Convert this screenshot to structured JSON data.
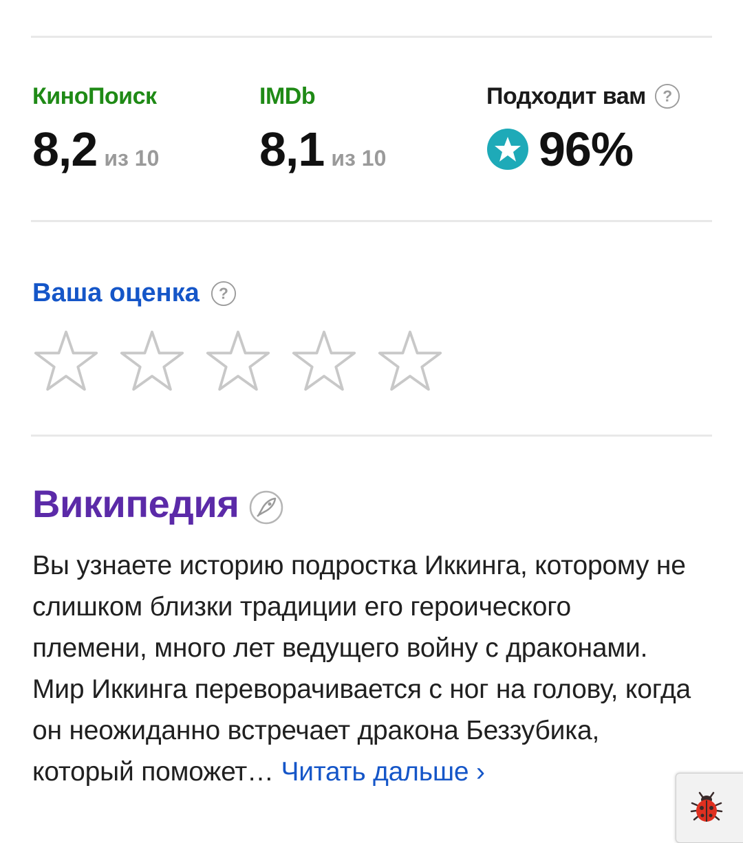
{
  "ratings": {
    "kinopoisk": {
      "label": "КиноПоиск",
      "value": "8,2",
      "scale": "из 10",
      "color": "#1f8a16"
    },
    "imdb": {
      "label": "IMDb",
      "value": "8,1",
      "scale": "из 10",
      "color": "#1f8a16"
    },
    "match": {
      "label": "Подходит вам",
      "value": "96%",
      "icon": "star-badge-icon",
      "badge_color": "#1eaab8"
    }
  },
  "your_rating": {
    "label": "Ваша оценка",
    "stars_total": 5,
    "stars_selected": 0
  },
  "wikipedia": {
    "title": "Википедия",
    "text": "Вы узнаете историю подростка Иккинга, которому не слишком близки традиции его героического племени, много лет ведущего войну с драконами. Мир Иккинга переворачивается с ног на голову, когда он неожиданно встречает дракона Беззубика, который поможет…",
    "read_more": "Читать дальше ›"
  }
}
